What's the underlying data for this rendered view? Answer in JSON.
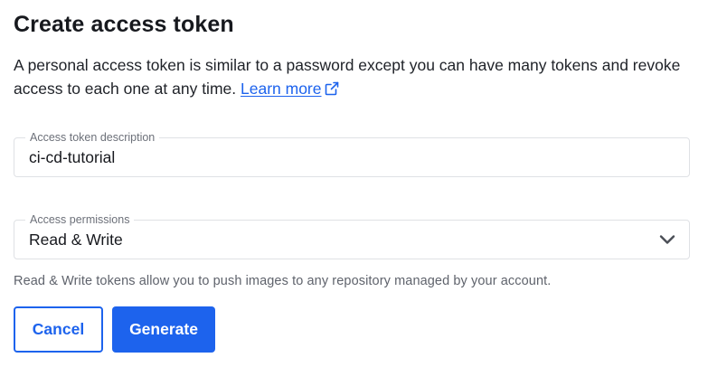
{
  "dialog": {
    "title": "Create access token",
    "description": "A personal access token is similar to a password except you can have many tokens and revoke access to each one at any time.",
    "learn_more": "Learn more"
  },
  "token_description": {
    "label": "Access token description",
    "value": "ci-cd-tutorial"
  },
  "permissions": {
    "label": "Access permissions",
    "selected": "Read & Write",
    "helper": "Read & Write tokens allow you to push images to any repository managed by your account."
  },
  "actions": {
    "cancel": "Cancel",
    "generate": "Generate"
  },
  "colors": {
    "accent": "#1d63ed",
    "text": "#17191e",
    "muted": "#6c7079",
    "border": "#dfe1e5"
  },
  "icons": {
    "learn_more": "external-link-icon",
    "permissions": "chevron-down-icon"
  }
}
